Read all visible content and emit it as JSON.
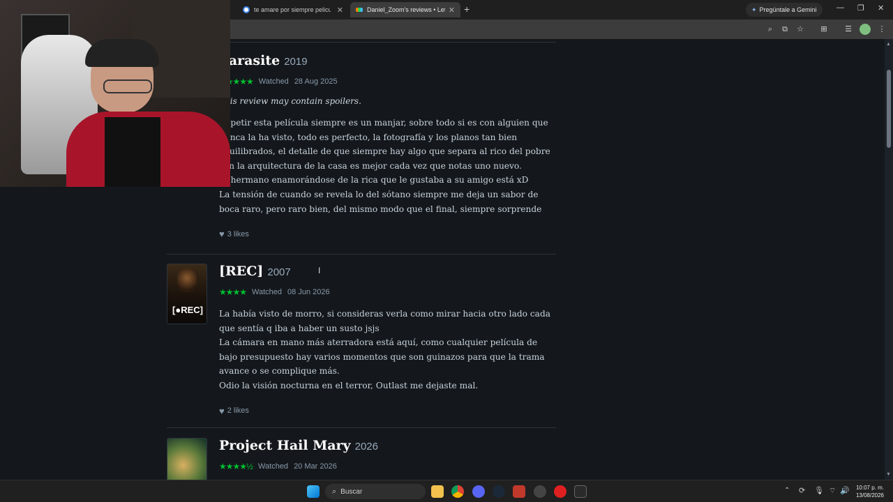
{
  "browser": {
    "tabs": [
      {
        "label": "te amare por siempre pelicula"
      },
      {
        "label": "Daniel_Zoom's reviews • Letterb"
      }
    ],
    "gemini_label": "Pregúntale a Gemini"
  },
  "reviews": [
    {
      "title": "Parasite",
      "year": "2019",
      "stars": "★★★★★",
      "watched_label": "Watched",
      "watched_date": "28 Aug 2025",
      "spoiler": "This review may contain spoilers.",
      "paragraphs": [
        "Repetir esta película siempre es un manjar, sobre todo si es con alguien que nunca la ha visto, todo es perfecto, la fotografía y los planos tan bien equilibrados, el detalle de que siempre hay algo que separa al rico del pobre con la arquitectura de la casa es mejor cada vez que notas uno nuevo.",
        "El hermano enamorándose de la rica que le gustaba a su amigo está xD",
        "La tensión de cuando se revela lo del sótano siempre me deja un sabor de boca raro, pero raro bien, del mismo modo que el final, siempre sorprende"
      ],
      "likes": "3 likes"
    },
    {
      "title": "[REC]",
      "year": "2007",
      "stars": "★★★★",
      "watched_label": "Watched",
      "watched_date": "08 Jun 2026",
      "poster_text": "[●REC]",
      "paragraphs": [
        "La había visto de morro, si consideras verla como mirar hacia otro lado cada que sentía q iba a haber un susto jsjs",
        "La cámara en mano más aterradora está aquí, como cualquier película de bajo presupuesto hay varios momentos que son guinazos para que la trama avance o se complique más.",
        "Odio la visión nocturna en el terror, Outlast me dejaste mal."
      ],
      "likes": "2 likes"
    },
    {
      "title": "Project Hail Mary",
      "year": "2026",
      "stars": "★★★★½",
      "watched_label": "Watched",
      "watched_date": "20 Mar 2026"
    }
  ],
  "taskbar": {
    "search_placeholder": "Buscar",
    "time": "10:07 p. m.",
    "date": "13/08/2026"
  },
  "colors": {
    "page_bg": "#14181c",
    "star_green": "#00c030",
    "text": "#c8d2dc"
  }
}
